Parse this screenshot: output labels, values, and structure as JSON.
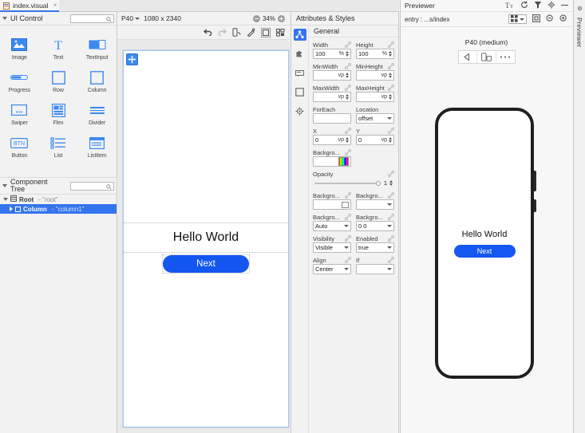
{
  "window": {
    "tab_label": "index.visual",
    "tab_icon": "file-visual-icon",
    "close_icon": "close-icon"
  },
  "left_panel": {
    "title": "UI Control",
    "search_placeholder": "",
    "components": [
      {
        "label": "Image",
        "icon": "image-icon"
      },
      {
        "label": "Text",
        "icon": "text-t-icon"
      },
      {
        "label": "TextInput",
        "icon": "textinput-icon"
      },
      {
        "label": "Progress",
        "icon": "progress-bar-icon"
      },
      {
        "label": "Row",
        "icon": "row-square-icon"
      },
      {
        "label": "Column",
        "icon": "column-square-icon"
      },
      {
        "label": "Swiper",
        "icon": "swiper-dots-icon"
      },
      {
        "label": "Flex",
        "icon": "flex-layout-icon"
      },
      {
        "label": "Divider",
        "icon": "divider-lines-icon"
      },
      {
        "label": "Button",
        "icon": "button-btn-icon"
      },
      {
        "label": "List",
        "icon": "list-icon"
      },
      {
        "label": "ListItem",
        "icon": "listitem-icon"
      }
    ],
    "tree": {
      "title": "Component Tree",
      "search_placeholder": "",
      "rows": [
        {
          "name": "Root",
          "value": "- \"root\"",
          "icon": "root-icon",
          "selected": false
        },
        {
          "name": "Column",
          "value": "- \"column1\"",
          "icon": "column-box-icon",
          "selected": true
        }
      ]
    }
  },
  "center": {
    "device": "P40",
    "resolution": "1080 x 2340",
    "zoom": "34%",
    "zoom_out_icon": "zoom-out-icon",
    "zoom_in_icon": "zoom-in-icon",
    "toolbar_icons": [
      "undo-icon",
      "redo-icon",
      "device-rotate-icon",
      "magic-wand-icon",
      "frame-icon",
      "component-grid-icon"
    ],
    "canvas": {
      "move_handle_icon": "move-handle-icon",
      "hello_text": "Hello World",
      "next_button": "Next"
    }
  },
  "attributes": {
    "title": "Attributes & Styles",
    "strip_icons": [
      "general-node-icon",
      "puzzle-icon",
      "event-icon",
      "square-icon",
      "gear-icon"
    ],
    "section": "General",
    "link_icon": "link-icon",
    "fields": [
      {
        "label": "Width",
        "value": "100",
        "unit": "%",
        "type": "spin"
      },
      {
        "label": "Height",
        "value": "100",
        "unit": "%",
        "type": "spin"
      },
      {
        "label": "MinWidth",
        "value": "",
        "unit": "vp",
        "type": "spin"
      },
      {
        "label": "MinHeight",
        "value": "",
        "unit": "vp",
        "type": "spin"
      },
      {
        "label": "MaxWidth",
        "value": "",
        "unit": "vp",
        "type": "spin"
      },
      {
        "label": "MaxHeight",
        "value": "",
        "unit": "vp",
        "type": "spin"
      },
      {
        "label": "ForEach",
        "value": "",
        "unit": "",
        "type": "text"
      },
      {
        "label": "Location",
        "value": "offset",
        "unit": "",
        "type": "select"
      },
      {
        "label": "X",
        "value": "0",
        "unit": "vp",
        "type": "spin"
      },
      {
        "label": "Y",
        "value": "0",
        "unit": "vp",
        "type": "spin"
      },
      {
        "label": "Backgro...",
        "value": "",
        "unit": "",
        "type": "color"
      },
      {
        "label": "Opacity",
        "value": "1",
        "unit": "",
        "type": "slider"
      },
      {
        "label": "Backgro...",
        "value": "",
        "unit": "",
        "type": "image"
      },
      {
        "label": "Backgro...",
        "value": "",
        "unit": "",
        "type": "select"
      },
      {
        "label": "Backgro...",
        "value": "Auto",
        "unit": "",
        "type": "select"
      },
      {
        "label": "Backgro...",
        "value": "0 0",
        "unit": "",
        "type": "select"
      },
      {
        "label": "Visibility",
        "value": "Visible",
        "unit": "",
        "type": "select"
      },
      {
        "label": "Enabled",
        "value": "true",
        "unit": "",
        "type": "select"
      },
      {
        "label": "Align",
        "value": "Center",
        "unit": "",
        "type": "select"
      },
      {
        "label": "If",
        "value": "",
        "unit": "",
        "type": "select"
      }
    ]
  },
  "previewer": {
    "title": "Previewer",
    "head_icons": [
      "text-size-icon",
      "refresh-icon",
      "filter-icon",
      "settings-gear-icon",
      "minimize-icon"
    ],
    "entry": "entry : ...s/index",
    "bar_icons": [
      "multi-device-grid-icon",
      "dropdown-caret-icon",
      "fit-frame-icon",
      "zoom-out-icon",
      "zoom-in-icon"
    ],
    "device_name": "P40 (medium)",
    "device_controls": [
      "back-arrow-icon",
      "rotate-device-icon",
      "more-dots-icon"
    ],
    "screen": {
      "hello_text": "Hello World",
      "next_button": "Next"
    }
  },
  "rail": {
    "label": "Previewer",
    "icon": "gear-icon"
  },
  "colors": {
    "accent_blue": "#3574f0",
    "button_blue": "#1456f0",
    "panel_bg": "#f2f2f2",
    "canvas_bg": "#e9e9e9"
  }
}
